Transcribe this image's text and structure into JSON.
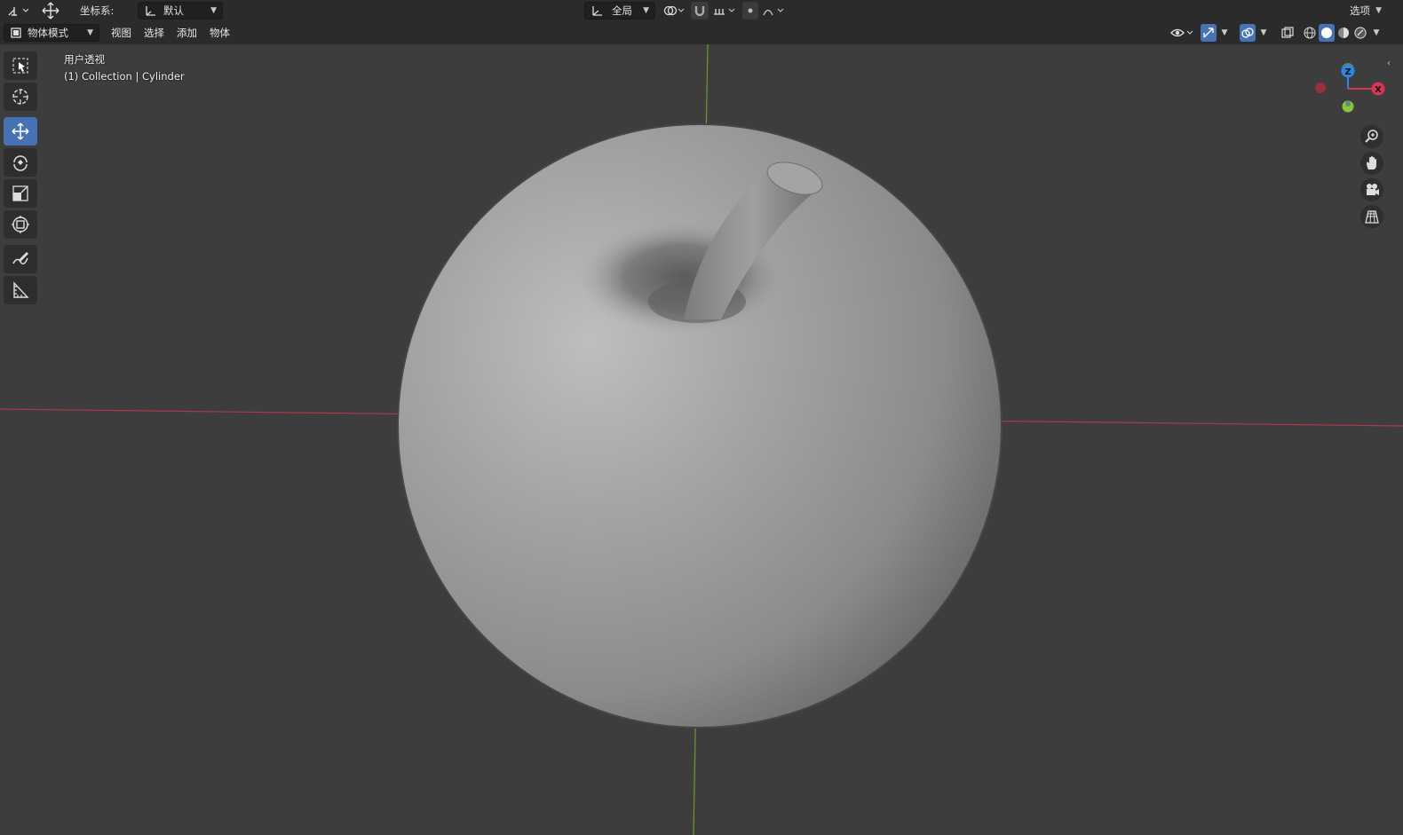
{
  "tool_settings": {
    "coord_label": "坐标系:",
    "coord_value": "默认",
    "pivot_value": "全局",
    "options_label": "选项"
  },
  "header": {
    "mode_label": "物体模式",
    "menus": [
      "视图",
      "选择",
      "添加",
      "物体"
    ]
  },
  "viewport": {
    "view_name": "用户透视",
    "object_info": "(1) Collection | Cylinder",
    "gizmo_axes": {
      "z": "Z",
      "x": "X"
    }
  },
  "colors": {
    "accent": "#4772b3",
    "x_axis": "#d6364f",
    "y_axis": "#8cc43a",
    "z_axis": "#2f85e3",
    "background": "#3d3d3d",
    "header": "#2b2b2b"
  },
  "icons": {
    "toolbar": [
      "select-box-icon",
      "cursor-icon",
      "move-icon",
      "rotate-icon",
      "scale-icon",
      "transform-icon",
      "annotate-icon",
      "measure-icon"
    ],
    "nav": [
      "zoom-icon",
      "pan-hand-icon",
      "camera-icon",
      "grid-ortho-icon"
    ]
  }
}
